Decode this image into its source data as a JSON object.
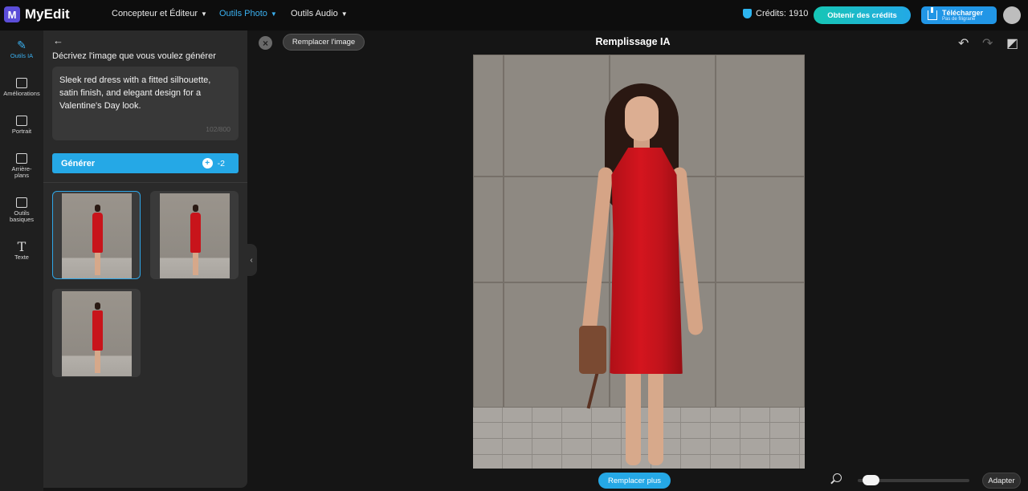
{
  "app": {
    "logo_letter": "M",
    "name": "MyEdit"
  },
  "topnav": [
    {
      "label": "Concepteur et Éditeur",
      "active": false
    },
    {
      "label": "Outils Photo",
      "active": true
    },
    {
      "label": "Outils Audio",
      "active": false
    }
  ],
  "header": {
    "credits_label": "Crédits: 1910",
    "get_credits_label": "Obtenir des crédits",
    "download_label": "Télécharger",
    "download_sub": "Pas de filigrane"
  },
  "rail": [
    {
      "label": "Outils IA",
      "icon": "magic-wand-icon",
      "active": true
    },
    {
      "label": "Améliorations",
      "icon": "enhance-image-icon",
      "active": false
    },
    {
      "label": "Portrait",
      "icon": "portrait-icon",
      "active": false
    },
    {
      "label": "Arrière-plans",
      "icon": "background-icon",
      "active": false
    },
    {
      "label": "Outils basiques",
      "icon": "crop-icon",
      "active": false
    },
    {
      "label": "Texte",
      "icon": "text-icon",
      "active": false
    }
  ],
  "panel": {
    "title": "Décrivez l'image que vous voulez générer",
    "prompt": "Sleek red dress with a fitted silhouette, satin finish, and elegant design for a Valentine's Day look.",
    "prompt_count": "102/800",
    "generate_label": "Générer",
    "generate_cost": "-2"
  },
  "canvas": {
    "replace_label": "Remplacer l'image",
    "title": "Remplissage IA",
    "replace_more_label": "Remplacer plus",
    "fit_label": "Adapter",
    "zoom_level": 0.05
  },
  "colors": {
    "accent": "#25a8e6",
    "brand": "#5b4dd8",
    "dress": "#c8141b"
  }
}
